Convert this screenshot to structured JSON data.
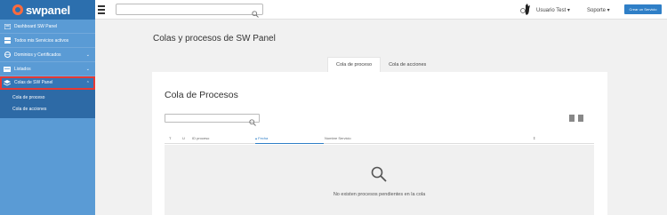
{
  "brand": {
    "name": "swpanel"
  },
  "sidebar": {
    "items": [
      {
        "label": "Dashboard SW Panel",
        "icon": "dashboard-icon"
      },
      {
        "label": "Todos mis Servicios activos",
        "icon": "servers-icon"
      },
      {
        "label": "Dominios y Certificados",
        "icon": "globe-icon"
      },
      {
        "label": "Listados",
        "icon": "list-icon"
      },
      {
        "label": "Colas de SW Panel",
        "icon": "layers-icon"
      }
    ],
    "subitems": [
      {
        "label": "Cola de proceso"
      },
      {
        "label": "Cola de acciones"
      }
    ]
  },
  "topbar": {
    "search_placeholder": "",
    "user": "Usuario Test",
    "support": "Soporte",
    "create_button": "Crear un Servicio"
  },
  "main": {
    "page_title": "Colas y procesos de SW Panel",
    "tabs": [
      {
        "label": "Cola de proceso",
        "active": true
      },
      {
        "label": "Cola de acciones",
        "active": false
      }
    ],
    "card": {
      "title": "Cola de Procesos",
      "search_placeholder": "",
      "columns": [
        "T",
        "U",
        "ID proceso",
        "Fecha",
        "Nombre Servicio"
      ],
      "empty_message": "No existen procesos pendientes en la cola"
    }
  },
  "colors": {
    "sidebar": "#5a9bd5",
    "sidebar_dark": "#2c6fae",
    "accent": "#2f7fc7",
    "highlight": "#e53935"
  }
}
